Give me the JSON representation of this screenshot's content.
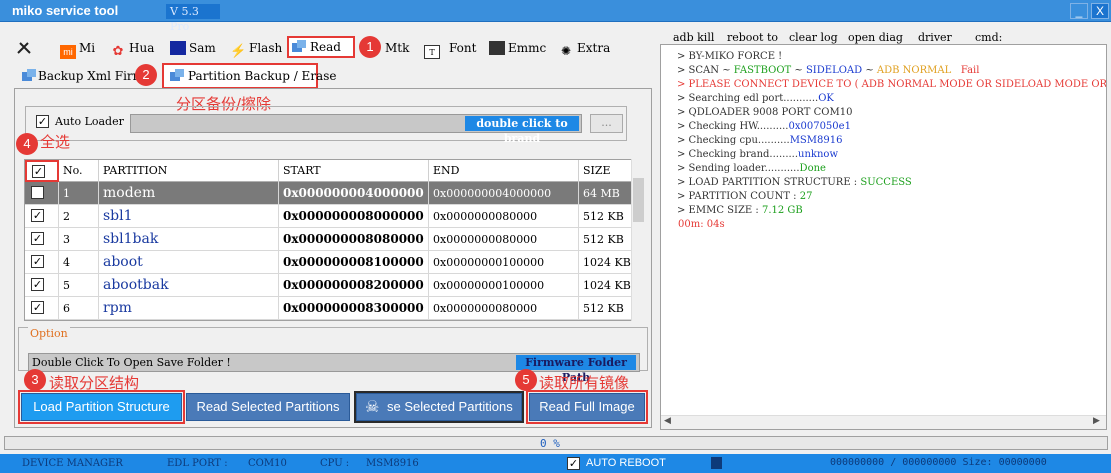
{
  "window": {
    "title": "miko service tool",
    "version": "V 5.3 Pro",
    "minimize": "_",
    "close": "X"
  },
  "tabs": [
    {
      "label": "",
      "icon": "tools-icon"
    },
    {
      "label": "Mi",
      "icon": "mi-logo-icon"
    },
    {
      "label": "Hua",
      "icon": "huawei-logo-icon"
    },
    {
      "label": "Sam",
      "icon": "samsung-logo-icon"
    },
    {
      "label": "Flash",
      "icon": "lightning-icon"
    },
    {
      "label": "Read",
      "icon": "database-icon"
    },
    {
      "label": "Mtk",
      "icon": ""
    },
    {
      "label": "Font",
      "icon": "font-file-icon"
    },
    {
      "label": "Emmc",
      "icon": "emmc-chip-icon"
    },
    {
      "label": "Extra",
      "icon": "extra-icon"
    }
  ],
  "subtabs": {
    "backup_xml": "Backup Xml Firm",
    "partition": "Partition Backup / Erase"
  },
  "annotations": {
    "n1": "1",
    "n2": "2",
    "n3": "3",
    "n4": "4",
    "n5": "5",
    "partition_note": "分区备份/擦除",
    "select_all": "全选",
    "read_structure": "读取分区结构",
    "read_full": "读取所有镜像"
  },
  "autoloader": {
    "label": "Auto Loader",
    "brand_button": "double click to brand",
    "browse": "..."
  },
  "table": {
    "headers": {
      "no": "No.",
      "partition": "PARTITION",
      "start": "START",
      "end": "END",
      "size": "SIZE"
    },
    "rows": [
      {
        "no": "1",
        "name": "modem",
        "start": "0x000000004000000",
        "end": "0x000000004000000",
        "size": "64 MB"
      },
      {
        "no": "2",
        "name": "sbl1",
        "start": "0x000000008000000",
        "end": "0x0000000080000",
        "size": "512 KB"
      },
      {
        "no": "3",
        "name": "sbl1bak",
        "start": "0x000000008080000",
        "end": "0x0000000080000",
        "size": "512 KB"
      },
      {
        "no": "4",
        "name": "aboot",
        "start": "0x000000008100000",
        "end": "0x00000000100000",
        "size": "1024 KB"
      },
      {
        "no": "5",
        "name": "abootbak",
        "start": "0x000000008200000",
        "end": "0x00000000100000",
        "size": "1024 KB"
      },
      {
        "no": "6",
        "name": "rpm",
        "start": "0x000000008300000",
        "end": "0x0000000080000",
        "size": "512 KB"
      }
    ]
  },
  "option": {
    "label": "Option",
    "save_folder": "Double Click To Open Save Folder !",
    "firmware_path": "Firmware Folder Path"
  },
  "actions": {
    "load": "Load Partition Structure",
    "read_selected": "Read Selected Partitions",
    "erase_selected": "se Selected Partitions",
    "read_full": "Read Full Image"
  },
  "right_toolbar": {
    "adb_kill": "adb kill",
    "reboot_to": "reboot to",
    "clear_log": "clear log",
    "open_diag": "open diag",
    "driver": "driver",
    "cmd": "cmd:"
  },
  "log": {
    "l1": "> BY-MIKO FORCE !",
    "l2a": "> SCAN ~ ",
    "l2b": "FASTBOOT",
    "l2c": " ~ ",
    "l2d": "SIDELOAD",
    "l2e": " ~ ",
    "l2f": "ADB NORMAL",
    "l2g": "Fail",
    "l3": "> PLEASE CONNECT DEVICE TO  ( ADB NORMAL MODE OR SIDELOAD MODE OR",
    "l4a": "> Searching edl port...........",
    "l4b": "OK",
    "l5": "> QDLOADER 9008 PORT COM10",
    "l6a": "> Checking HW..........",
    "l6b": "0x007050e1",
    "l7a": "> Checking cpu..........",
    "l7b": "MSM8916",
    "l8a": "> Checking brand.........",
    "l8b": "unknow",
    "l9a": "> Sending loader...........",
    "l9b": "Done",
    "l10a": "> LOAD PARTITION  STRUCTURE  :  ",
    "l10b": "SUCCESS",
    "l11a": "> PARTITION COUNT  :  ",
    "l11b": "27",
    "l12a": "> EMMC SIZE   :  ",
    "l12b": "7.12 GB",
    "l13": "00m: 04s"
  },
  "progress": {
    "text": "0 %",
    "value": 0
  },
  "statusbar": {
    "device_manager": "DEVICE MANAGER",
    "edl_port_label": "EDL PORT :",
    "edl_port": "COM10",
    "cpu_label": "CPU :",
    "cpu": "MSM8916",
    "auto_reboot": "AUTO REBOOT",
    "counter": "000000000 / 000000000 Size: 00000000"
  },
  "colors": {
    "accent": "#1e88e5",
    "highlight": "#e53935",
    "title_bar": "#3a8fdc"
  }
}
